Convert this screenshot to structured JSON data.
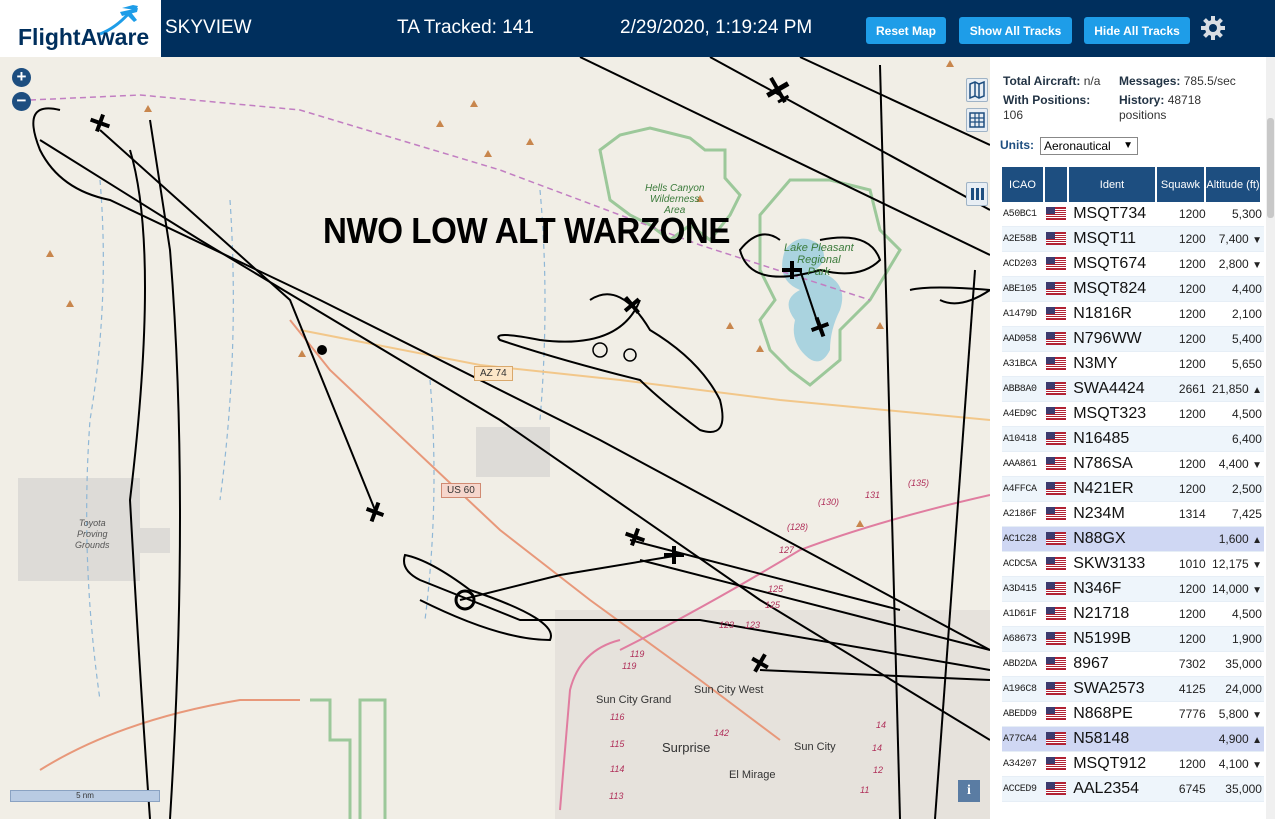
{
  "header": {
    "logo_text": "FlightAware",
    "site_title": "SKYVIEW",
    "ta_tracked": "TA Tracked: 141",
    "datetime": "2/29/2020, 1:19:24 PM",
    "buttons": {
      "reset_map": "Reset Map",
      "show_all_tracks": "Show All Tracks",
      "hide_all_tracks": "Hide All Tracks"
    },
    "accent_color": "#1e9de8",
    "bar_color": "#002f5d",
    "settings_icon": "gear-icon"
  },
  "map": {
    "overlay_title": "NWO LOW ALT WARZONE",
    "zoom_in": "+",
    "zoom_out": "−",
    "scale_label": "5 nm",
    "info_label": "i",
    "place_labels": {
      "hells_canyon": [
        "Hells Canyon",
        "Wilderness",
        "Area"
      ],
      "lake_pleasant": [
        "Lake Pleasant",
        "Regional",
        "Park"
      ],
      "toyota": [
        "Toyota",
        "Proving",
        "Grounds"
      ],
      "sun_city_grand": "Sun City Grand",
      "sun_city_west": "Sun City West",
      "surprise": "Surprise",
      "sun_city": "Sun City",
      "el_mirage": "El Mirage"
    },
    "road_shields": {
      "az74": "AZ 74",
      "us60": "US 60"
    },
    "route_numbers": [
      "(130)",
      "131",
      "(135)",
      "(128)",
      "127",
      "125",
      "125",
      "123",
      "123",
      "119",
      "119",
      "116",
      "115",
      "114",
      "113",
      "142",
      "14",
      "14",
      "12",
      "11"
    ]
  },
  "sidebar": {
    "stats": {
      "total_aircraft_label": "Total Aircraft:",
      "total_aircraft_value": "n/a",
      "messages_label": "Messages:",
      "messages_value": "785.5/sec",
      "with_positions_label": "With Positions:",
      "with_positions_value": "106",
      "history_label": "History:",
      "history_value": "48718",
      "history_unit": "positions"
    },
    "units_label": "Units:",
    "units_value": "Aeronautical",
    "columns": [
      "ICAO",
      "",
      "Ident",
      "Squawk",
      "Altitude (ft)"
    ],
    "rows": [
      {
        "icao": "A50BC1",
        "ident": "MSQT734",
        "squawk": "1200",
        "alt": "5,300",
        "trend": ""
      },
      {
        "icao": "A2E58B",
        "ident": "MSQT11",
        "squawk": "1200",
        "alt": "7,400",
        "trend": "▼"
      },
      {
        "icao": "ACD203",
        "ident": "MSQT674",
        "squawk": "1200",
        "alt": "2,800",
        "trend": "▼"
      },
      {
        "icao": "ABE105",
        "ident": "MSQT824",
        "squawk": "1200",
        "alt": "4,400",
        "trend": ""
      },
      {
        "icao": "A1479D",
        "ident": "N1816R",
        "squawk": "1200",
        "alt": "2,100",
        "trend": ""
      },
      {
        "icao": "AAD058",
        "ident": "N796WW",
        "squawk": "1200",
        "alt": "5,400",
        "trend": ""
      },
      {
        "icao": "A31BCA",
        "ident": "N3MY",
        "squawk": "1200",
        "alt": "5,650",
        "trend": ""
      },
      {
        "icao": "ABB8A0",
        "ident": "SWA4424",
        "squawk": "2661",
        "alt": "21,850",
        "trend": "▲"
      },
      {
        "icao": "A4ED9C",
        "ident": "MSQT323",
        "squawk": "1200",
        "alt": "4,500",
        "trend": ""
      },
      {
        "icao": "A10418",
        "ident": "N16485",
        "squawk": "",
        "alt": "6,400",
        "trend": ""
      },
      {
        "icao": "AAA861",
        "ident": "N786SA",
        "squawk": "1200",
        "alt": "4,400",
        "trend": "▼"
      },
      {
        "icao": "A4FFCA",
        "ident": "N421ER",
        "squawk": "1200",
        "alt": "2,500",
        "trend": ""
      },
      {
        "icao": "A2186F",
        "ident": "N234M",
        "squawk": "1314",
        "alt": "7,425",
        "trend": ""
      },
      {
        "icao": "AC1C28",
        "ident": "N88GX",
        "squawk": "",
        "alt": "1,600",
        "trend": "▲"
      },
      {
        "icao": "ACDC5A",
        "ident": "SKW3133",
        "squawk": "1010",
        "alt": "12,175",
        "trend": "▼"
      },
      {
        "icao": "A3D415",
        "ident": "N346F",
        "squawk": "1200",
        "alt": "14,000",
        "trend": "▼"
      },
      {
        "icao": "A1D61F",
        "ident": "N21718",
        "squawk": "1200",
        "alt": "4,500",
        "trend": ""
      },
      {
        "icao": "A68673",
        "ident": "N5199B",
        "squawk": "1200",
        "alt": "1,900",
        "trend": ""
      },
      {
        "icao": "ABD2DA",
        "ident": "8967",
        "squawk": "7302",
        "alt": "35,000",
        "trend": ""
      },
      {
        "icao": "A196C8",
        "ident": "SWA2573",
        "squawk": "4125",
        "alt": "24,000",
        "trend": ""
      },
      {
        "icao": "ABEDD9",
        "ident": "N868PE",
        "squawk": "7776",
        "alt": "5,800",
        "trend": "▼"
      },
      {
        "icao": "A77CA4",
        "ident": "N58148",
        "squawk": "",
        "alt": "4,900",
        "trend": "▲"
      },
      {
        "icao": "A34207",
        "ident": "MSQT912",
        "squawk": "1200",
        "alt": "4,100",
        "trend": "▼"
      },
      {
        "icao": "ACCED9",
        "ident": "AAL2354",
        "squawk": "6745",
        "alt": "35,000",
        "trend": ""
      }
    ],
    "selected_rows": [
      13,
      21
    ]
  }
}
